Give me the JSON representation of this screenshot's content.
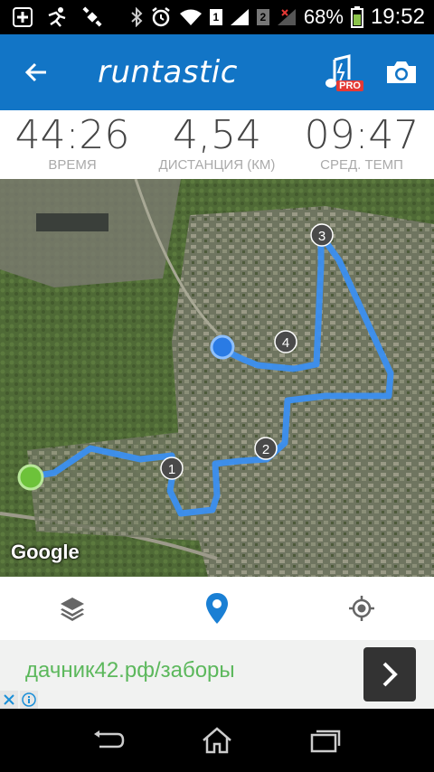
{
  "status_bar": {
    "icons": [
      "plus-box-icon",
      "runner-icon",
      "satellite-icon",
      "bluetooth-icon",
      "alarm-icon",
      "wifi-icon",
      "sim1-signal-icon",
      "sim2-signal-icon",
      "battery-icon"
    ],
    "sim1": "1",
    "sim2": "2",
    "battery": "68%",
    "time": "19:52"
  },
  "toolbar": {
    "logo": "runtastic",
    "pro_badge": "PRO",
    "accent": "#1275c6"
  },
  "stats": [
    {
      "value": "44:26",
      "label": "ВРЕМЯ"
    },
    {
      "value": "4,54",
      "label": "ДИСТАНЦИЯ (КМ)"
    },
    {
      "value": "09:47",
      "label": "СРЕД. ТЕМП"
    }
  ],
  "map": {
    "attribution": "Google",
    "markers": [
      "1",
      "2",
      "3",
      "4"
    ],
    "route_color": "#3b8ff0",
    "start_color": "#6dc23a",
    "end_color": "#2a7be4"
  },
  "bottom_nav": {
    "items": [
      "layers-icon",
      "location-pin-icon",
      "my-location-icon"
    ],
    "active_color": "#1a7fd4"
  },
  "ad": {
    "text": "дачник42.рф/заборы"
  }
}
